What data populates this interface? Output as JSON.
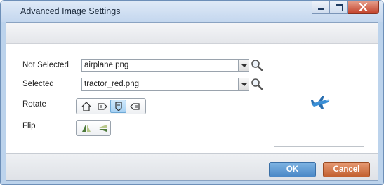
{
  "window": {
    "title": "Advanced Image Settings"
  },
  "form": {
    "not_selected": {
      "label": "Not Selected",
      "value": "airplane.png"
    },
    "selected": {
      "label": "Selected",
      "value": "tractor_red.png"
    },
    "rotate": {
      "label": "Rotate",
      "icons": [
        "rotate-home-icon",
        "rotate-right-icon",
        "rotate-down-icon",
        "rotate-left-icon"
      ],
      "active_index": 2
    },
    "flip": {
      "label": "Flip",
      "icons": [
        "flip-horizontal-icon",
        "flip-vertical-icon"
      ]
    }
  },
  "preview": {
    "image": "airplane-icon"
  },
  "footer": {
    "ok_label": "OK",
    "cancel_label": "Cancel"
  },
  "colors": {
    "ok": "#4a88c7",
    "cancel": "#c2602f",
    "frame": "#bcd3ec"
  }
}
